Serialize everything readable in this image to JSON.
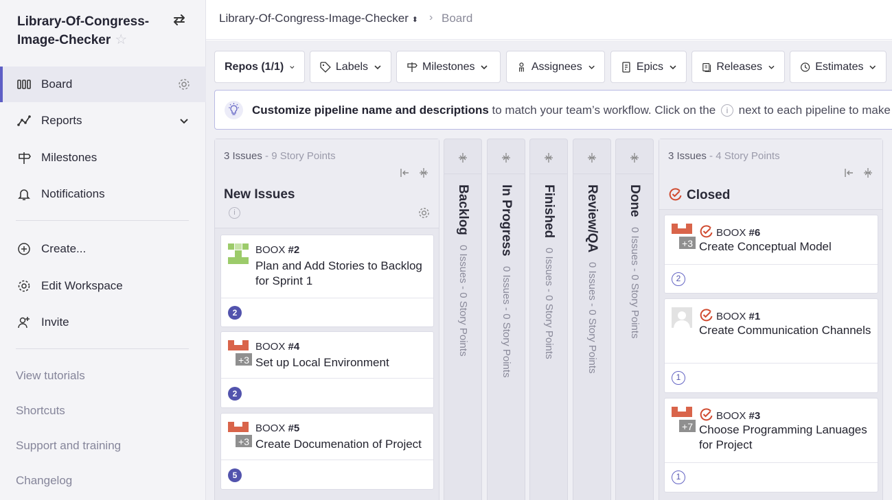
{
  "workspace": {
    "name": "Library-Of-Congress-Image-Checker"
  },
  "sidebar": {
    "nav": [
      {
        "label": "Board"
      },
      {
        "label": "Reports"
      },
      {
        "label": "Milestones"
      },
      {
        "label": "Notifications"
      },
      {
        "label": "Create..."
      },
      {
        "label": "Edit Workspace"
      },
      {
        "label": "Invite"
      }
    ],
    "links": [
      {
        "label": "View tutorials"
      },
      {
        "label": "Shortcuts"
      },
      {
        "label": "Support and training"
      },
      {
        "label": "Changelog"
      }
    ]
  },
  "breadcrumb": {
    "repo": "Library-Of-Congress-Image-Checker",
    "page": "Board"
  },
  "filters": [
    {
      "label": "Repos (1/1)"
    },
    {
      "label": "Labels"
    },
    {
      "label": "Milestones"
    },
    {
      "label": "Assignees"
    },
    {
      "label": "Epics"
    },
    {
      "label": "Releases"
    },
    {
      "label": "Estimates"
    }
  ],
  "banner": {
    "bold": "Customize pipeline name and descriptions",
    "text1": " to match your team’s workflow. Click on the ",
    "info": "i",
    "text2": " next to each pipeline to make"
  },
  "pipelines": {
    "new_issues": {
      "name": "New Issues",
      "issues": "3 Issues",
      "points": " - 9 Story Points",
      "cards": [
        {
          "repo": "BOOX ",
          "number": "#2",
          "title": "Plan and Add Stories to Backlog for Sprint 1",
          "estimate": "2",
          "extra": ""
        },
        {
          "repo": "BOOX ",
          "number": "#4",
          "title": "Set up Local Environment",
          "estimate": "2",
          "extra": "+3"
        },
        {
          "repo": "BOOX ",
          "number": "#5",
          "title": "Create Documenation of Project",
          "estimate": "5",
          "extra": "+3"
        }
      ]
    },
    "collapsed": [
      {
        "name": "Backlog",
        "count": "0 Issues - 0 Story Points"
      },
      {
        "name": "In Progress",
        "count": "0 Issues - 0 Story Points"
      },
      {
        "name": "Finished",
        "count": "0 Issues - 0 Story Points"
      },
      {
        "name": "Review/QA",
        "count": "0 Issues - 0 Story Points"
      },
      {
        "name": "Done",
        "count": "0 Issues - 0 Story Points"
      }
    ],
    "closed": {
      "name": "Closed",
      "issues": "3 Issues",
      "points": " - 4 Story Points",
      "cards": [
        {
          "repo": "BOOX ",
          "number": "#6",
          "title": "Create Conceptual Model",
          "estimate": "2",
          "extra": "+3"
        },
        {
          "repo": "BOOX ",
          "number": "#1",
          "title": "Create Communication Channels",
          "estimate": "1",
          "extra": ""
        },
        {
          "repo": "BOOX ",
          "number": "#3",
          "title": "Choose Programming Lanuages for Project",
          "estimate": "1",
          "extra": "+7"
        }
      ]
    }
  },
  "colors": {
    "accent": "#5e5fc5",
    "closed": "#d04a2f",
    "estimate": "#5253ad",
    "avatar_red": "#d9644a",
    "avatar_green": "#9ccb6a"
  }
}
